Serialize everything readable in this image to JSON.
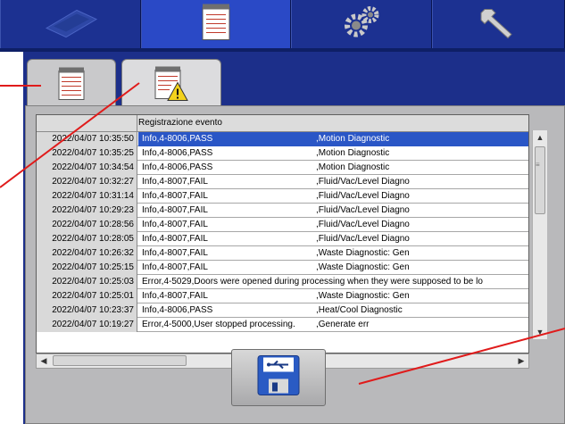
{
  "top_tabs": [
    {
      "name": "tray-icon"
    },
    {
      "name": "notepad-icon"
    },
    {
      "name": "gears-icon"
    },
    {
      "name": "wrench-icon"
    }
  ],
  "sub_tabs": [
    {
      "name": "notepad-icon"
    },
    {
      "name": "notepad-warning-icon"
    }
  ],
  "log": {
    "header": "Registrazione evento",
    "rows": [
      {
        "time": "2022/04/07 10:35:50",
        "message": "Info,4-8006,PASS",
        "source": ",Motion Diagnostic",
        "selected": true
      },
      {
        "time": "2022/04/07 10:35:25",
        "message": "Info,4-8006,PASS",
        "source": ",Motion Diagnostic"
      },
      {
        "time": "2022/04/07 10:34:54",
        "message": "Info,4-8006,PASS",
        "source": ",Motion Diagnostic"
      },
      {
        "time": "2022/04/07 10:32:27",
        "message": "Info,4-8007,FAIL",
        "source": ",Fluid/Vac/Level Diagno"
      },
      {
        "time": "2022/04/07 10:31:14",
        "message": "Info,4-8007,FAIL",
        "source": ",Fluid/Vac/Level Diagno"
      },
      {
        "time": "2022/04/07 10:29:23",
        "message": "Info,4-8007,FAIL",
        "source": ",Fluid/Vac/Level Diagno"
      },
      {
        "time": "2022/04/07 10:28:56",
        "message": "Info,4-8007,FAIL",
        "source": ",Fluid/Vac/Level Diagno"
      },
      {
        "time": "2022/04/07 10:28:05",
        "message": "Info,4-8007,FAIL",
        "source": ",Fluid/Vac/Level Diagno"
      },
      {
        "time": "2022/04/07 10:26:32",
        "message": "Info,4-8007,FAIL",
        "source": ",Waste Diagnostic: Gen"
      },
      {
        "time": "2022/04/07 10:25:15",
        "message": "Info,4-8007,FAIL",
        "source": ",Waste Diagnostic: Gen"
      },
      {
        "time": "2022/04/07 10:25:03",
        "message": "Error,4-5029,Doors were opened during processing when they were supposed to be lo",
        "source": ""
      },
      {
        "time": "2022/04/07 10:25:01",
        "message": "Info,4-8007,FAIL",
        "source": ",Waste Diagnostic: Gen"
      },
      {
        "time": "2022/04/07 10:23:37",
        "message": "Info,4-8006,PASS",
        "source": ",Heat/Cool Diagnostic"
      },
      {
        "time": "2022/04/07 10:19:27",
        "message": "Error,4-5000,User stopped processing.",
        "source": ",Generate err"
      }
    ]
  },
  "export_button": {
    "icon": "usb-save-icon"
  },
  "colors": {
    "frame": "#1c2f8a",
    "selection": "#2a56c6",
    "callout": "#e01b1b"
  }
}
